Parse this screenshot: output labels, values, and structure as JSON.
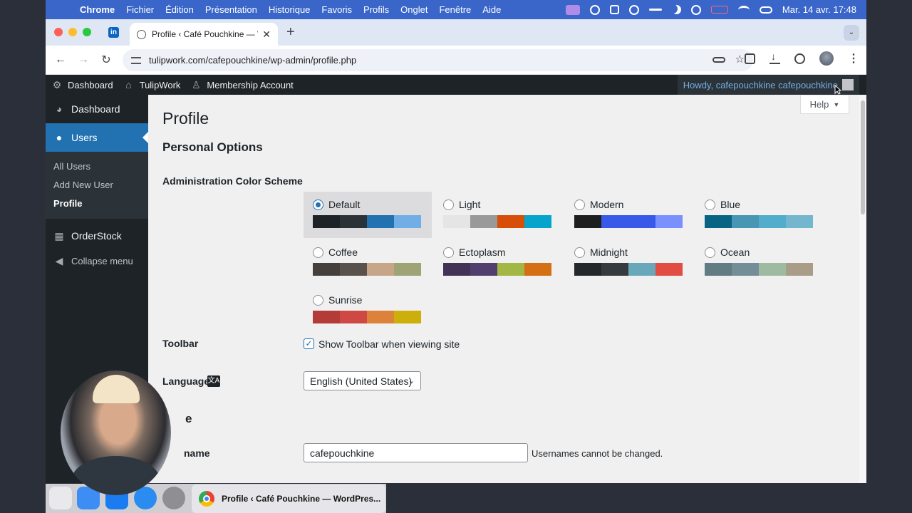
{
  "macos_menu": {
    "app": "Chrome",
    "items": [
      "Fichier",
      "Édition",
      "Présentation",
      "Historique",
      "Favoris",
      "Profils",
      "Onglet",
      "Fenêtre",
      "Aide"
    ],
    "datetime": "Mar. 14 avr.  17:48"
  },
  "browser": {
    "tab_title": "Profile ‹ Café Pouchkine — W",
    "url": "tulipwork.com/cafepouchkine/wp-admin/profile.php",
    "pinned_tab_label": "in"
  },
  "admin_bar": {
    "dashboard": "Dashboard",
    "site": "TulipWork",
    "membership": "Membership Account",
    "howdy": "Howdy, cafepouchkine cafepouchkine"
  },
  "sidebar": {
    "dashboard": "Dashboard",
    "users": "Users",
    "submenu": [
      "All Users",
      "Add New User",
      "Profile"
    ],
    "orderstock": "OrderStock",
    "collapse": "Collapse menu"
  },
  "page": {
    "help": "Help",
    "title": "Profile",
    "section": "Personal Options",
    "color_scheme_label": "Administration Color Scheme",
    "schemes": [
      {
        "name": "Default",
        "selected": true,
        "colors": [
          "#1d2327",
          "#2c3338",
          "#2271b1",
          "#72aee6"
        ]
      },
      {
        "name": "Light",
        "selected": false,
        "colors": [
          "#e5e5e5",
          "#999999",
          "#d64e07",
          "#04a4cc"
        ]
      },
      {
        "name": "Modern",
        "selected": false,
        "colors": [
          "#1e1e1e",
          "#3858e9",
          "#3858e9",
          "#7b90ff"
        ]
      },
      {
        "name": "Blue",
        "selected": false,
        "colors": [
          "#096484",
          "#4796b3",
          "#52accc",
          "#74b6ce"
        ]
      },
      {
        "name": "Coffee",
        "selected": false,
        "colors": [
          "#46403c",
          "#59524c",
          "#c7a589",
          "#9ea476"
        ]
      },
      {
        "name": "Ectoplasm",
        "selected": false,
        "colors": [
          "#413256",
          "#523f6d",
          "#a3b745",
          "#d46f15"
        ]
      },
      {
        "name": "Midnight",
        "selected": false,
        "colors": [
          "#25282b",
          "#363b3f",
          "#69a8bb",
          "#e14d43"
        ]
      },
      {
        "name": "Ocean",
        "selected": false,
        "colors": [
          "#627c83",
          "#738e96",
          "#9ebaa0",
          "#aa9d88"
        ]
      },
      {
        "name": "Sunrise",
        "selected": false,
        "colors": [
          "#b43c38",
          "#cf4944",
          "#dd823b",
          "#ccaf0b"
        ]
      }
    ],
    "toolbar_label": "Toolbar",
    "toolbar_checkbox": "Show Toolbar when viewing site",
    "toolbar_checked": true,
    "language_label": "Language",
    "language_value": "English (United States)",
    "name_section_partial": "e",
    "username_label_partial": "name",
    "username_value": "cafepouchkine",
    "username_desc": "Usernames cannot be changed."
  },
  "dock": {
    "chrome_window": "Profile ‹ Café Pouchkine — WordPres..."
  }
}
